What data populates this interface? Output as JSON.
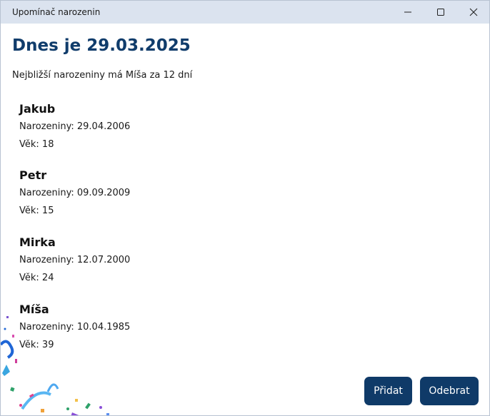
{
  "window": {
    "title": "Upomínač narozenin"
  },
  "header": {
    "today": "Dnes je 29.03.2025",
    "next_birthday": "Nejbližší narozeniny má Míša za 12 dní"
  },
  "people": [
    {
      "name": "Jakub",
      "birthday": "Narozeniny: 29.04.2006",
      "age": "Věk: 18"
    },
    {
      "name": "Petr",
      "birthday": "Narozeniny: 09.09.2009",
      "age": "Věk: 15"
    },
    {
      "name": "Mirka",
      "birthday": "Narozeniny: 12.07.2000",
      "age": "Věk: 24"
    },
    {
      "name": "Míša",
      "birthday": "Narozeniny: 10.04.1985",
      "age": "Věk: 39"
    }
  ],
  "actions": {
    "add_label": "Přidat",
    "remove_label": "Odebrat"
  },
  "colors": {
    "titlebar": "#dbe3ef",
    "heading": "#103c6b",
    "button": "#0f3a68"
  },
  "icons": {
    "minimize": "minimize-icon",
    "maximize": "maximize-icon",
    "close": "close-icon"
  }
}
